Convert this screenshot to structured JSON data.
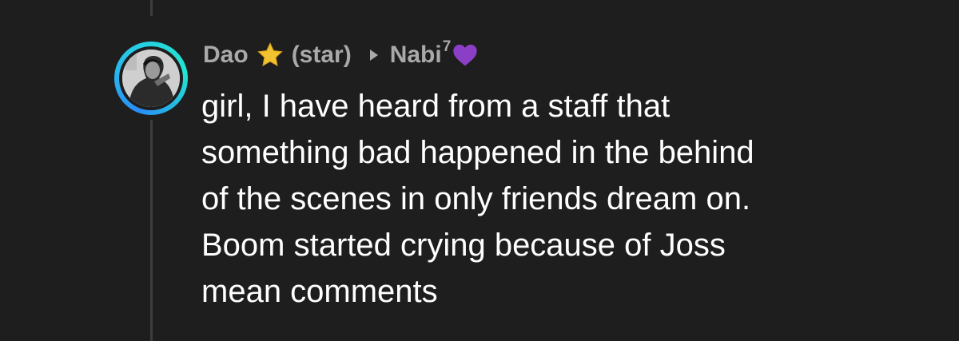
{
  "comment": {
    "author": "Dao",
    "author_badge_icon": "star-icon",
    "author_badge_text": "(star)",
    "reply_arrow_icon": "caret-right-icon",
    "reply_to": "Nabi",
    "reply_to_superscript": "7",
    "reply_to_emoji_icon": "purple-heart-icon",
    "avatar_ring_colors": [
      "#2a8cf6",
      "#22e6d0"
    ],
    "body_lines": [
      "girl, I have heard from a staff that",
      "something bad happened in the behind",
      "of the scenes in only friends dream on.",
      "Boom started crying because of Joss",
      "mean comments"
    ]
  }
}
